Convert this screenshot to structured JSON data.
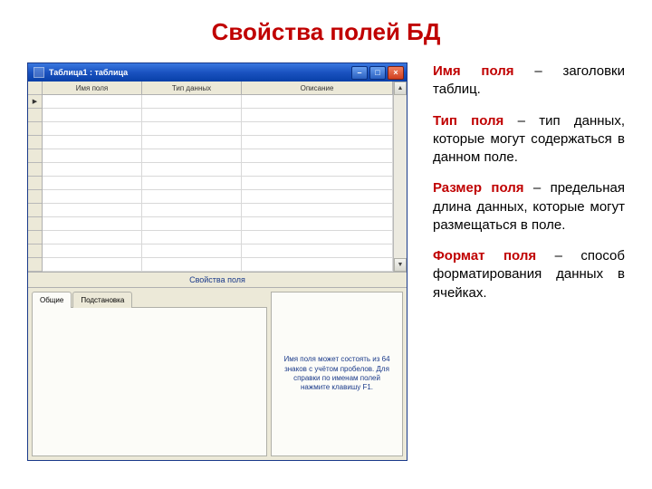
{
  "title": "Свойства полей БД",
  "window": {
    "title": "Таблица1 : таблица",
    "headers": {
      "col1": "Имя поля",
      "col2": "Тип данных",
      "col3": "Описание"
    },
    "section_label": "Свойства поля",
    "tabs": {
      "general": "Общие",
      "lookup": "Подстановка"
    },
    "hint": "Имя поля может состоять из 64 знаков с учётом пробелов. Для справки по именам полей нажмите клавишу F1."
  },
  "definitions": {
    "d1": {
      "term": "Имя поля",
      "text": " – заголовки таблиц."
    },
    "d2": {
      "term": "Тип поля",
      "text": " – тип данных, которые могут содержаться в данном поле."
    },
    "d3": {
      "term": "Размер поля",
      "text": " – предельная длина данных, которые могут размещаться в поле."
    },
    "d4": {
      "term": "Формат поля",
      "text": " – способ форматирования данных в ячейках."
    }
  }
}
